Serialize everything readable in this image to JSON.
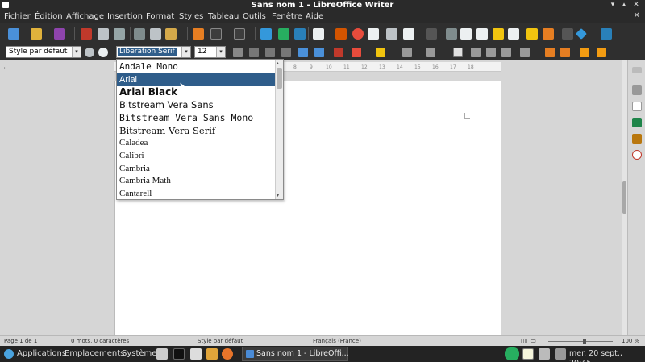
{
  "window": {
    "title": "Sans nom 1 - LibreOffice Writer",
    "minimize": "▾",
    "maximize": "▴",
    "close": "✕"
  },
  "menu": {
    "items": [
      "Fichier",
      "Édition",
      "Affichage",
      "Insertion",
      "Format",
      "Styles",
      "Tableau",
      "Outils",
      "Fenêtre",
      "Aide"
    ],
    "close_doc": "✕"
  },
  "formatting": {
    "paragraph_style": "Style par défaut",
    "font_name": "Liberation Serif",
    "font_size": "12",
    "combo_arrow": "▾"
  },
  "font_list": {
    "items": [
      {
        "name": "Andale Mono",
        "family": "\"DejaVu Sans Mono\", monospace",
        "size": "11px",
        "weight": "normal"
      },
      {
        "name": "Arial",
        "family": "\"Liberation Sans\", sans-serif",
        "size": "11px",
        "weight": "normal",
        "selected": true
      },
      {
        "name": "Arial Black",
        "family": "\"DejaVu Sans\", sans-serif",
        "size": "12px",
        "weight": "bold"
      },
      {
        "name": "Bitstream Vera Sans",
        "family": "\"DejaVu Sans\", sans-serif",
        "size": "11.5px",
        "weight": "normal"
      },
      {
        "name": "Bitstream Vera Sans Mono",
        "family": "\"DejaVu Sans Mono\", monospace",
        "size": "11.5px",
        "weight": "normal"
      },
      {
        "name": "Bitstream Vera Serif",
        "family": "\"DejaVu Serif\", serif",
        "size": "11.5px",
        "weight": "normal"
      },
      {
        "name": "Caladea",
        "family": "\"Liberation Serif\", serif",
        "size": "11px",
        "weight": "normal"
      },
      {
        "name": "Calibri",
        "family": "\"Liberation Serif\", serif",
        "size": "11px",
        "weight": "normal"
      },
      {
        "name": "Cambria",
        "family": "\"Liberation Serif\", serif",
        "size": "11px",
        "weight": "normal"
      },
      {
        "name": "Cambria Math",
        "family": "\"Liberation Serif\", serif",
        "size": "11px",
        "weight": "normal"
      },
      {
        "name": "Cantarell",
        "family": "\"Liberation Serif\", serif",
        "size": "11px",
        "weight": "normal"
      }
    ],
    "scroll_up": "▴",
    "scroll_down": "▾"
  },
  "ruler": {
    "ticks": [
      "8",
      "9",
      "10",
      "11",
      "12",
      "13",
      "14",
      "15",
      "16",
      "17",
      "18"
    ]
  },
  "status": {
    "page": "Page 1 de 1",
    "words": "0 mots, 0 caractères",
    "style": "Style par défaut",
    "language": "Français (France)",
    "zoom": "100 %"
  },
  "taskbar": {
    "applications": "Applications",
    "places": "Emplacements",
    "system": "Système",
    "task_label": "Sans nom 1 - LibreOffi...",
    "clock": "mer. 20 sept., 20:45"
  },
  "colors": {
    "selection": "#2f5d8a",
    "toolbar_bg": "#2f2f2f",
    "page_bg": "#ffffff"
  }
}
